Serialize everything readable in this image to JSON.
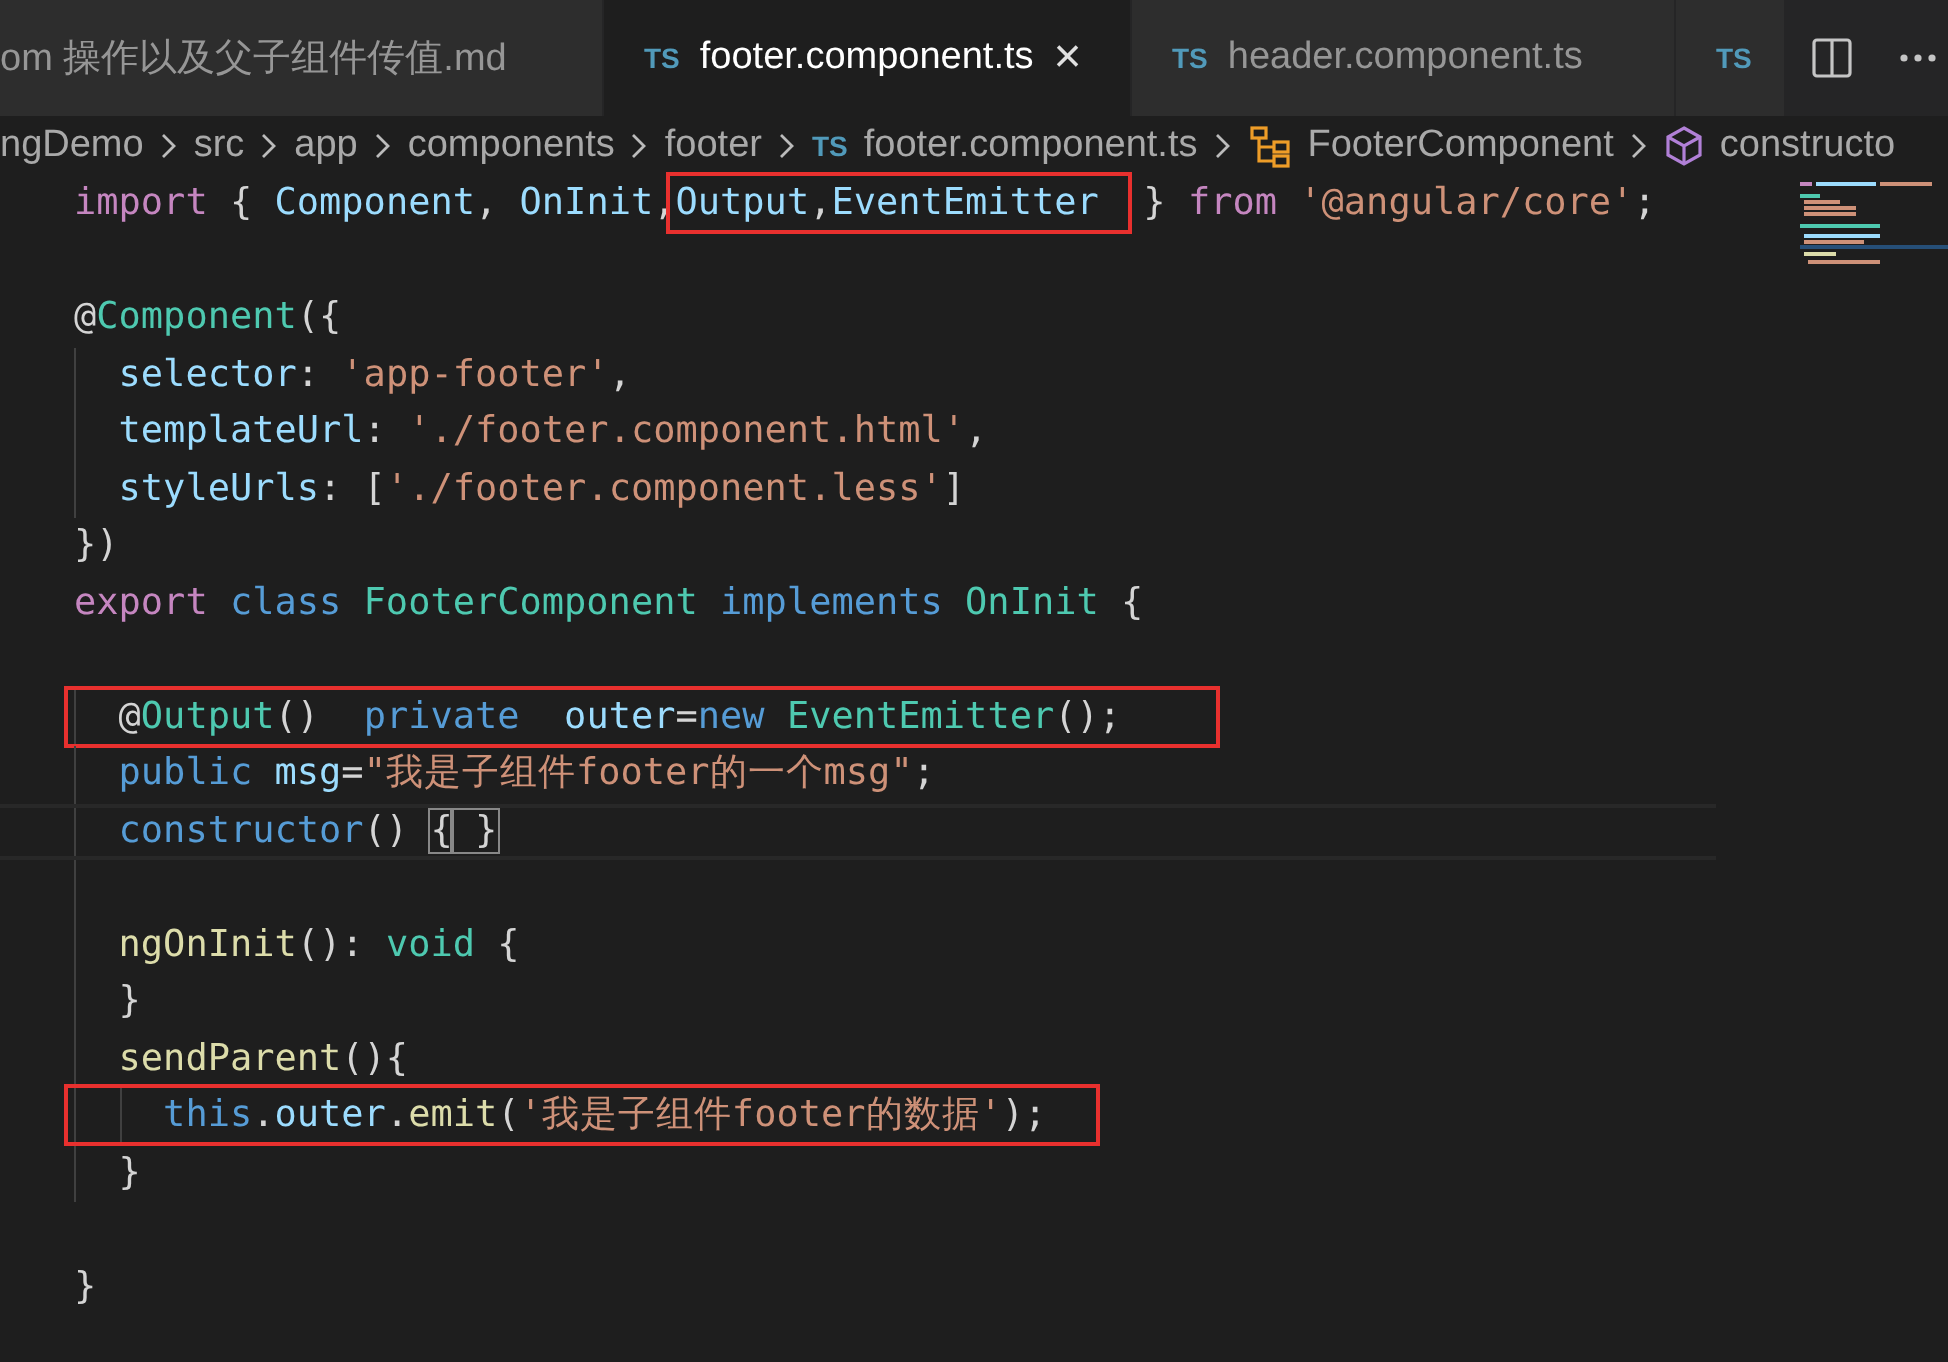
{
  "tabs": [
    {
      "label": "om 操作以及父子组件传值.md",
      "selected": false
    },
    {
      "icon": "TS",
      "label": "footer.component.ts",
      "selected": true,
      "close": "×"
    },
    {
      "icon": "TS",
      "label": "header.component.ts",
      "selected": false
    },
    {
      "icon": "TS",
      "selected": false
    }
  ],
  "breadcrumbs": [
    {
      "kind": "folder",
      "label": "ngDemo"
    },
    {
      "kind": "folder",
      "label": "src"
    },
    {
      "kind": "folder",
      "label": "app"
    },
    {
      "kind": "folder",
      "label": "components"
    },
    {
      "kind": "folder",
      "label": "footer"
    },
    {
      "kind": "file",
      "icon": "TS",
      "label": "footer.component.ts"
    },
    {
      "kind": "class",
      "label": "FooterComponent"
    },
    {
      "kind": "method",
      "label": "constructo"
    }
  ],
  "lines": [
    {
      "kind": "code",
      "tokens": [
        {
          "text": "import",
          "kind": "kw"
        },
        {
          "text": " { ",
          "kind": "p"
        },
        {
          "text": "Component",
          "kind": "var"
        },
        {
          "text": ", ",
          "kind": "p"
        },
        {
          "text": "OnInit",
          "kind": "var"
        },
        {
          "text": ",",
          "kind": "p"
        },
        {
          "kind": "box",
          "tokens": [
            {
              "text": "Output",
              "kind": "var"
            },
            {
              "text": ",",
              "kind": "p"
            },
            {
              "text": "EventEmitter ",
              "kind": "var"
            }
          ]
        },
        {
          "text": " } ",
          "kind": "p"
        },
        {
          "text": "from",
          "kind": "kw"
        },
        {
          "text": " '@angular/core'",
          "kind": "str"
        },
        {
          "text": ";",
          "kind": "p"
        }
      ]
    },
    {
      "kind": "blank"
    },
    {
      "kind": "code",
      "tokens": [
        {
          "text": "@",
          "kind": "p"
        },
        {
          "text": "Component",
          "kind": "type"
        },
        {
          "text": "({",
          "kind": "p"
        }
      ]
    },
    {
      "kind": "code",
      "tokens": [
        {
          "text": "  selector",
          "kind": "var"
        },
        {
          "text": ": ",
          "kind": "p"
        },
        {
          "text": "'app-footer'",
          "kind": "str"
        },
        {
          "text": ",",
          "kind": "p"
        }
      ]
    },
    {
      "kind": "code",
      "tokens": [
        {
          "text": "  templateUrl",
          "kind": "var"
        },
        {
          "text": ": ",
          "kind": "p"
        },
        {
          "text": "'./footer.component.html'",
          "kind": "str"
        },
        {
          "text": ",",
          "kind": "p"
        }
      ]
    },
    {
      "kind": "code",
      "tokens": [
        {
          "text": "  styleUrls",
          "kind": "var"
        },
        {
          "text": ": [",
          "kind": "p"
        },
        {
          "text": "'./footer.component.less'",
          "kind": "str"
        },
        {
          "text": "]",
          "kind": "p"
        }
      ]
    },
    {
      "kind": "code",
      "tokens": [
        {
          "text": "})",
          "kind": "p"
        }
      ]
    },
    {
      "kind": "code",
      "tokens": [
        {
          "text": "export",
          "kind": "kw"
        },
        {
          "text": " class",
          "kind": "st"
        },
        {
          "text": " FooterComponent",
          "kind": "type"
        },
        {
          "text": " implements",
          "kind": "st"
        },
        {
          "text": " OnInit",
          "kind": "type"
        },
        {
          "text": " {",
          "kind": "p"
        }
      ]
    },
    {
      "kind": "blank"
    },
    {
      "kind": "code",
      "tokens": [
        {
          "kind": "box",
          "tokens": [
            {
              "text": "  @",
              "kind": "p"
            },
            {
              "text": "Output",
              "kind": "type"
            },
            {
              "text": "()  ",
              "kind": "p"
            },
            {
              "text": "private",
              "kind": "st"
            },
            {
              "text": "  outer",
              "kind": "var"
            },
            {
              "text": "=",
              "kind": "p"
            },
            {
              "text": "new",
              "kind": "st"
            },
            {
              "text": " EventEmitter",
              "kind": "type"
            },
            {
              "text": "();    ",
              "kind": "p"
            }
          ]
        }
      ]
    },
    {
      "kind": "code",
      "tokens": [
        {
          "text": "  public",
          "kind": "st"
        },
        {
          "text": " msg",
          "kind": "var"
        },
        {
          "text": "=",
          "kind": "p"
        },
        {
          "text": "\"我是子组件footer的一个msg\"",
          "kind": "str"
        },
        {
          "text": ";",
          "kind": "p"
        }
      ]
    },
    {
      "kind": "code",
      "current": true,
      "tokens": [
        {
          "text": "  constructor",
          "kind": "st"
        },
        {
          "text": "() ",
          "kind": "p"
        },
        {
          "text": "{",
          "kind": "match"
        },
        {
          "text": " }",
          "kind": "match"
        }
      ]
    },
    {
      "kind": "blank"
    },
    {
      "kind": "code",
      "tokens": [
        {
          "text": "  ngOnInit",
          "kind": "fn"
        },
        {
          "text": "(): ",
          "kind": "p"
        },
        {
          "text": "void",
          "kind": "type"
        },
        {
          "text": " {",
          "kind": "p"
        }
      ]
    },
    {
      "kind": "code",
      "tokens": [
        {
          "text": "  }",
          "kind": "p"
        }
      ]
    },
    {
      "kind": "code",
      "tokens": [
        {
          "text": "  sendParent",
          "kind": "fn"
        },
        {
          "text": "(){",
          "kind": "p"
        }
      ]
    },
    {
      "kind": "code",
      "tokens": [
        {
          "kind": "box",
          "tokens": [
            {
              "text": "    this",
              "kind": "st"
            },
            {
              "text": ".",
              "kind": "p"
            },
            {
              "text": "outer",
              "kind": "var"
            },
            {
              "text": ".",
              "kind": "p"
            },
            {
              "text": "emit",
              "kind": "fn"
            },
            {
              "text": "(",
              "kind": "p"
            },
            {
              "text": "'我是子组件footer的数据'",
              "kind": "str"
            },
            {
              "text": ");  ",
              "kind": "p"
            }
          ]
        }
      ]
    },
    {
      "kind": "code",
      "tokens": [
        {
          "text": "  }",
          "kind": "p"
        }
      ]
    },
    {
      "kind": "blank"
    },
    {
      "kind": "code",
      "tokens": [
        {
          "text": "}",
          "kind": "p"
        }
      ]
    }
  ]
}
